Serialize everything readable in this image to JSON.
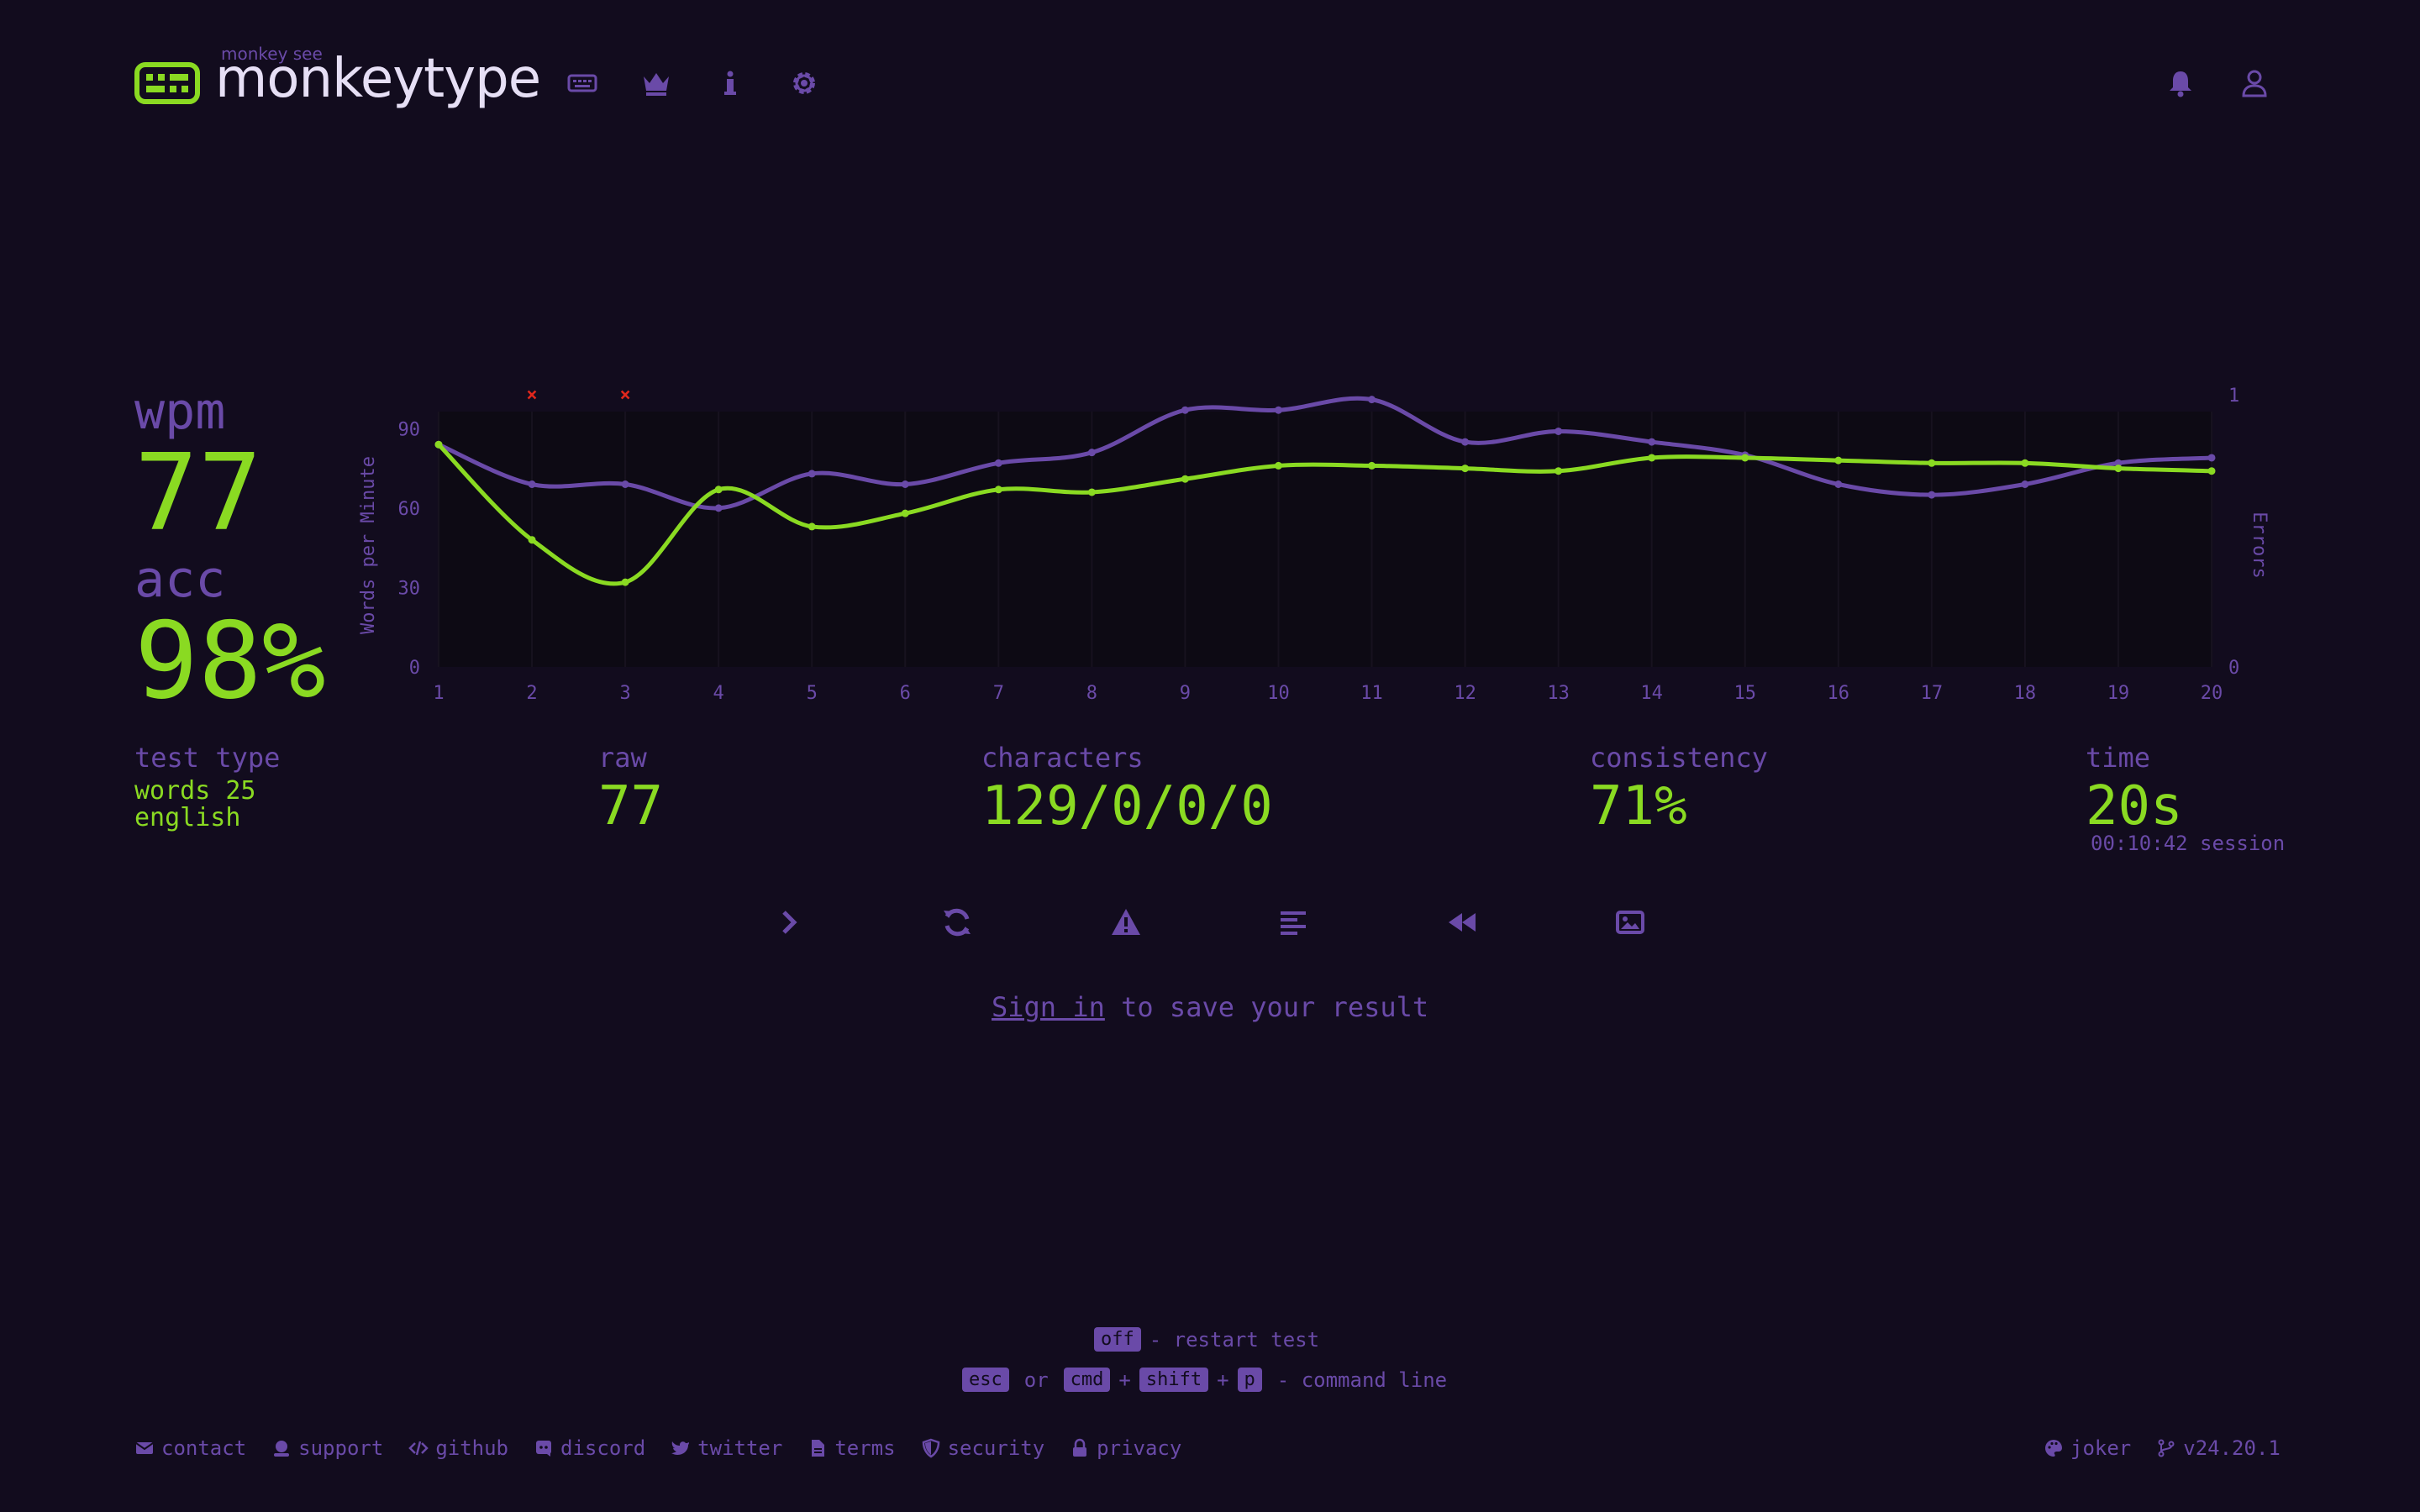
{
  "header": {
    "tagline": "monkey see",
    "title": "monkeytype",
    "nav_icons": [
      "keyboard-icon",
      "crown-icon",
      "info-icon",
      "gear-icon"
    ],
    "right_icons": [
      "bell-icon",
      "user-icon"
    ]
  },
  "result": {
    "wpm_label": "wpm",
    "wpm_value": "77",
    "acc_label": "acc",
    "acc_value": "98%",
    "test_type_label": "test type",
    "test_type_line1": "words 25",
    "test_type_line2": "english",
    "raw_label": "raw",
    "raw_value": "77",
    "characters_label": "characters",
    "characters_value": "129/0/0/0",
    "consistency_label": "consistency",
    "consistency_value": "71%",
    "time_label": "time",
    "time_value": "20s",
    "session": "00:10:42 session"
  },
  "chart_data": {
    "type": "line",
    "x": [
      1,
      2,
      3,
      4,
      5,
      6,
      7,
      8,
      9,
      10,
      11,
      12,
      13,
      14,
      15,
      16,
      17,
      18,
      19,
      20
    ],
    "ylabel": "Words per Minute",
    "y2label": "Errors",
    "yticks": [
      "0",
      "30",
      "60",
      "90"
    ],
    "y2ticks": [
      "0",
      "1"
    ],
    "ylim": [
      0,
      92
    ],
    "y2lim": [
      0,
      1
    ],
    "series": [
      {
        "values": [
          84,
          48,
          32,
          67,
          53,
          58,
          67,
          66,
          71,
          76,
          76,
          75,
          74,
          79,
          79,
          78,
          77,
          77,
          75,
          74
        ],
        "color": "#8ada22"
      },
      {
        "values": [
          84,
          69,
          69,
          60,
          73,
          69,
          77,
          81,
          97,
          97,
          101,
          85,
          89,
          85,
          80,
          69,
          65,
          69,
          77,
          79
        ],
        "color": "#6a4aa8"
      }
    ],
    "errors": [
      {
        "x": 2,
        "y": 1
      },
      {
        "x": 3,
        "y": 1
      }
    ],
    "error_marker": "×",
    "grid": true
  },
  "actions": [
    "next-test-icon",
    "restart-icon",
    "warning-icon",
    "words-history-icon",
    "replay-icon",
    "screenshot-icon"
  ],
  "signin": {
    "link": "Sign in",
    "rest": " to save your result"
  },
  "hints": {
    "restart_key": "off",
    "restart_text": "- restart test",
    "esc_key": "esc",
    "or": "or",
    "cmd_key": "cmd",
    "plus1": "+",
    "shift_key": "shift",
    "plus2": "+",
    "p_key": "p",
    "command_text": "- command line"
  },
  "footer": {
    "left": [
      {
        "label": "contact",
        "icon": "envelope-icon"
      },
      {
        "label": "support",
        "icon": "donate-icon"
      },
      {
        "label": "github",
        "icon": "code-icon"
      },
      {
        "label": "discord",
        "icon": "discord-icon"
      },
      {
        "label": "twitter",
        "icon": "twitter-icon"
      },
      {
        "label": "terms",
        "icon": "file-icon"
      },
      {
        "label": "security",
        "icon": "shield-icon"
      },
      {
        "label": "privacy",
        "icon": "lock-icon"
      }
    ],
    "theme": "joker",
    "version": "v24.20.1"
  },
  "colors": {
    "background": "#120c1e",
    "main": "#8ada22",
    "sub": "#6a4aa8",
    "text": "#e6dff5",
    "error": "#e0271c"
  }
}
